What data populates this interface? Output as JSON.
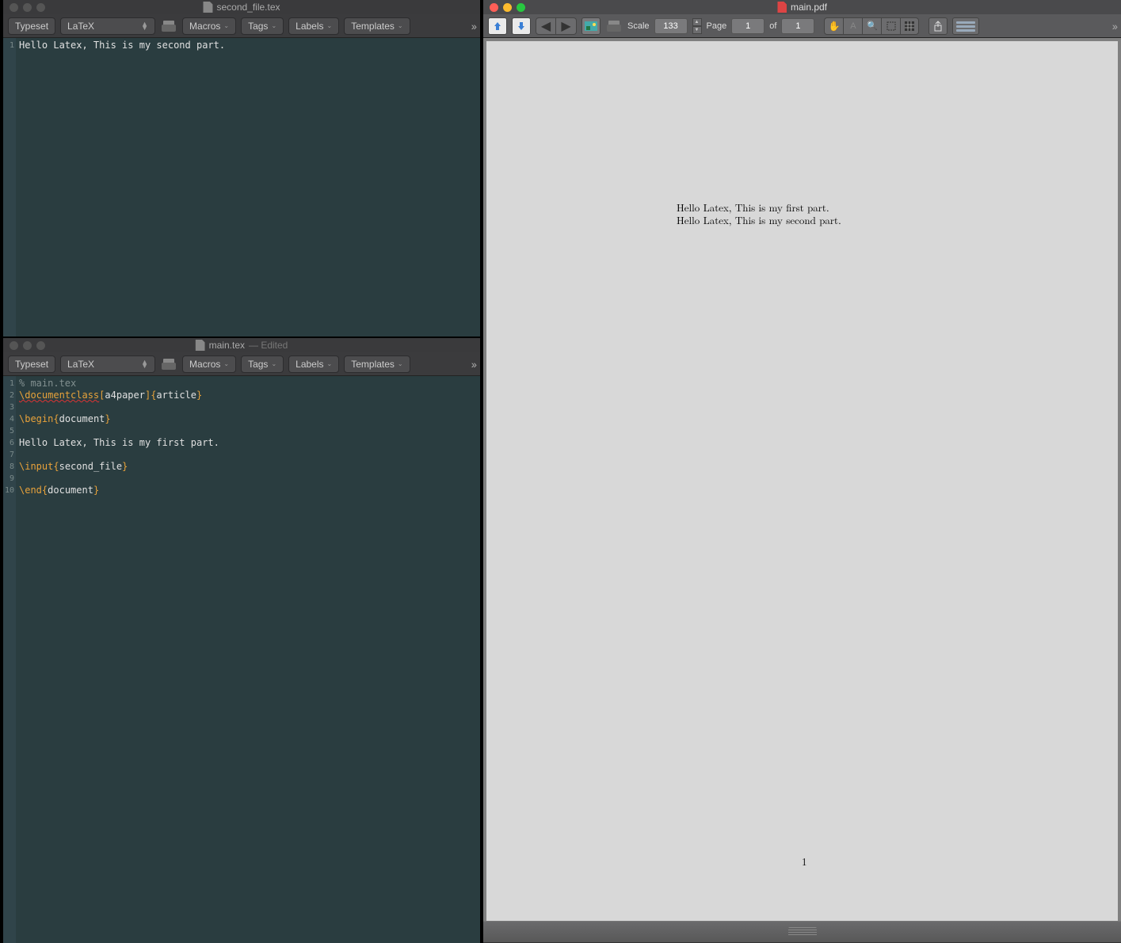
{
  "editor1": {
    "title": "second_file.tex",
    "toolbar": {
      "typeset": "Typeset",
      "engine": "LaTeX",
      "macros": "Macros",
      "tags": "Tags",
      "labels": "Labels",
      "templates": "Templates"
    },
    "gutter": [
      "1"
    ],
    "code": {
      "l1": "Hello Latex, This is my second part."
    }
  },
  "editor2": {
    "title": "main.tex",
    "title_suffix": " — Edited",
    "toolbar": {
      "typeset": "Typeset",
      "engine": "LaTeX",
      "macros": "Macros",
      "tags": "Tags",
      "labels": "Labels",
      "templates": "Templates"
    },
    "gutter": [
      "1",
      "2",
      "3",
      "4",
      "5",
      "6",
      "7",
      "8",
      "9",
      "10"
    ],
    "code": {
      "l1_comment": "% main.tex",
      "l2_cmd": "\\documentclass",
      "l2_b1": "[",
      "l2_a1": "a4paper",
      "l2_b2": "]{",
      "l2_a2": "article",
      "l2_b3": "}",
      "l4_cmd": "\\begin",
      "l4_b1": "{",
      "l4_a1": "document",
      "l4_b2": "}",
      "l6": "Hello Latex, This is my first part.",
      "l8_cmd": "\\input",
      "l8_b1": "{",
      "l8_a1": "second_file",
      "l8_b2": "}",
      "l10_cmd": "\\end",
      "l10_b1": "{",
      "l10_a1": "document",
      "l10_b2": "}"
    }
  },
  "pdf": {
    "title": "main.pdf",
    "scale_label": "Scale",
    "scale_value": "133",
    "page_label": "Page",
    "page_current": "1",
    "page_of": "of",
    "page_total": "1",
    "content": {
      "line1": "Hello Latex, This is my first part.",
      "line2": "Hello Latex, This is my second part.",
      "pagenum": "1"
    }
  }
}
